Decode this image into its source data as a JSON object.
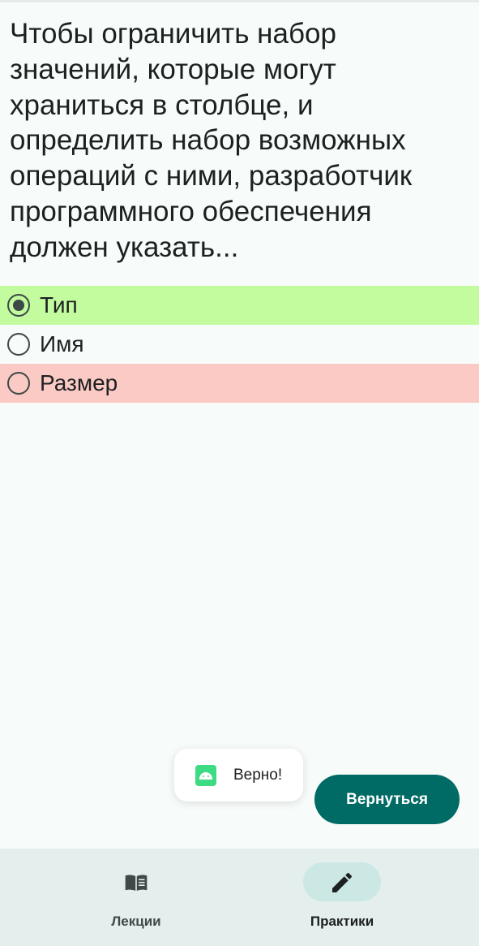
{
  "question": {
    "text": "Чтобы ограничить набор значений, которые могут храниться в столбце, и определить набор возможных операций с ними, разработчик программного обеспечения должен указать..."
  },
  "options": [
    {
      "label": "Тип",
      "selected": true,
      "state": "correct",
      "color": "#c3fb9f"
    },
    {
      "label": "Имя",
      "selected": false,
      "state": "neutral"
    },
    {
      "label": "Размер",
      "selected": false,
      "state": "wrong",
      "color": "#fccac4"
    }
  ],
  "toast": {
    "icon": "android-app-icon",
    "text": "Верно!"
  },
  "back_button": {
    "label": "Вернуться",
    "color": "#006a65"
  },
  "bottom_nav": {
    "items": [
      {
        "label": "Лекции",
        "icon": "book-icon",
        "active": false
      },
      {
        "label": "Практики",
        "icon": "pencil-icon",
        "active": true
      }
    ]
  }
}
